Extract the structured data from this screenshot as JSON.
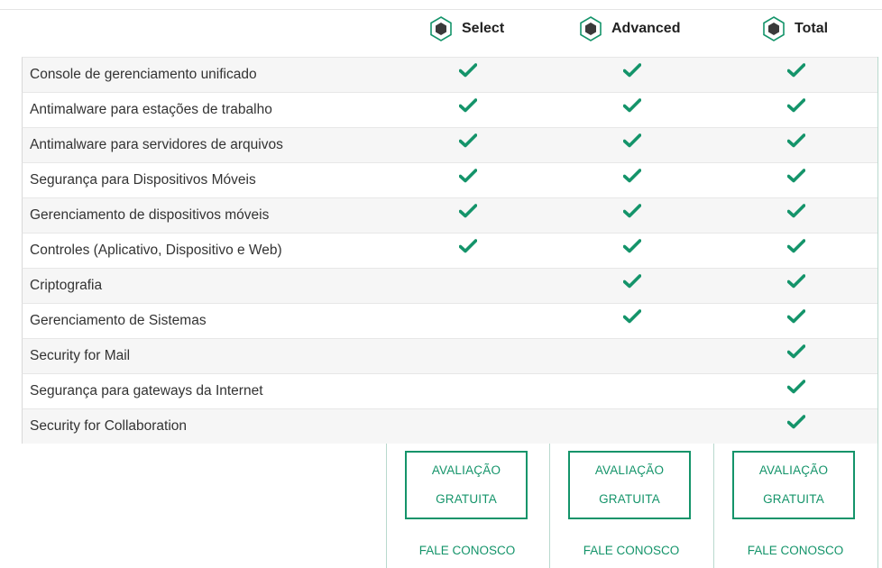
{
  "plans": [
    {
      "name": "Select",
      "icon": "hexagon-icon"
    },
    {
      "name": "Advanced",
      "icon": "hexagon-icon"
    },
    {
      "name": "Total",
      "icon": "hexagon-icon"
    }
  ],
  "features": [
    {
      "label": "Console de gerenciamento unificado",
      "included": [
        true,
        true,
        true
      ]
    },
    {
      "label": "Antimalware para estações de trabalho",
      "included": [
        true,
        true,
        true
      ]
    },
    {
      "label": "Antimalware para servidores de arquivos",
      "included": [
        true,
        true,
        true
      ]
    },
    {
      "label": "Segurança para Dispositivos Móveis",
      "included": [
        true,
        true,
        true
      ]
    },
    {
      "label": "Gerenciamento de dispositivos móveis",
      "included": [
        true,
        true,
        true
      ]
    },
    {
      "label": "Controles (Aplicativo, Dispositivo e Web)",
      "included": [
        true,
        true,
        true
      ]
    },
    {
      "label": "Criptografia",
      "included": [
        false,
        true,
        true
      ]
    },
    {
      "label": "Gerenciamento de Sistemas",
      "included": [
        false,
        true,
        true
      ]
    },
    {
      "label": "Security for Mail",
      "included": [
        false,
        false,
        true
      ]
    },
    {
      "label": "Segurança para gateways da Internet",
      "included": [
        false,
        false,
        true
      ]
    },
    {
      "label": "Security for Collaboration",
      "included": [
        false,
        false,
        true
      ]
    }
  ],
  "cta": {
    "line1": "AVALIAÇÃO",
    "line2": "GRATUITA"
  },
  "contact_label": "FALE CONOSCO",
  "colors": {
    "accent": "#14946a",
    "check": "#14946a",
    "icon_dark": "#3a3a3a",
    "divider": "#b9d9ce"
  }
}
